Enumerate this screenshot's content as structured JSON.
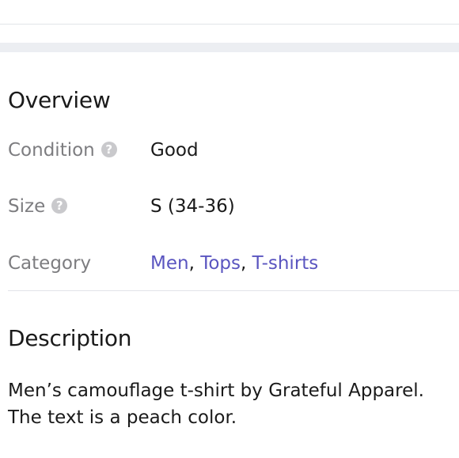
{
  "overview": {
    "title": "Overview",
    "rows": [
      {
        "label": "Condition",
        "value": "Good",
        "help_icon": "question-circle-icon",
        "help_glyph": "?"
      },
      {
        "label": "Size",
        "value": "S (34-36)",
        "help_icon": "question-circle-icon",
        "help_glyph": "?"
      },
      {
        "label": "Category",
        "links": [
          "Men",
          "Tops",
          "T-shirts"
        ],
        "separator": ","
      }
    ]
  },
  "description": {
    "title": "Description",
    "text": "Men’s camouflage t-shirt by Grateful Apparel. The text is a peach color."
  },
  "colors": {
    "link": "#5a55c0",
    "label": "#7d7d80",
    "text": "#1a1a1a",
    "help_icon_bg": "#c9c9cc",
    "band": "#eceef2",
    "divider": "#e2e4e9"
  }
}
